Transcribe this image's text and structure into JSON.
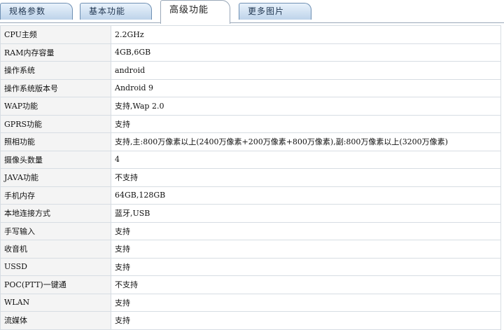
{
  "tabs": [
    {
      "label": "规格参数"
    },
    {
      "label": "基本功能"
    },
    {
      "label": "高级功能",
      "active": true
    },
    {
      "label": "更多图片"
    }
  ],
  "specs": [
    {
      "name": "CPU主频",
      "value": "2.2GHz"
    },
    {
      "name": "RAM内存容量",
      "value": "4GB,6GB"
    },
    {
      "name": "操作系统",
      "value": "android"
    },
    {
      "name": "操作系统版本号",
      "value": "Android 9"
    },
    {
      "name": "WAP功能",
      "value": "支持,Wap 2.0"
    },
    {
      "name": "GPRS功能",
      "value": "支持"
    },
    {
      "name": "照相功能",
      "value": "支持,主:800万像素以上(2400万像素+200万像素+800万像素),副:800万像素以上(3200万像素)"
    },
    {
      "name": "摄像头数量",
      "value": "4"
    },
    {
      "name": "JAVA功能",
      "value": "不支持"
    },
    {
      "name": "手机内存",
      "value": "64GB,128GB"
    },
    {
      "name": "本地连接方式",
      "value": "蓝牙,USB"
    },
    {
      "name": "手写输入",
      "value": "支持"
    },
    {
      "name": "收音机",
      "value": "支持"
    },
    {
      "name": "USSD",
      "value": "支持"
    },
    {
      "name": "POC(PTT)一键通",
      "value": "不支持"
    },
    {
      "name": "WLAN",
      "value": "支持"
    },
    {
      "name": "流媒体",
      "value": "支持"
    }
  ]
}
